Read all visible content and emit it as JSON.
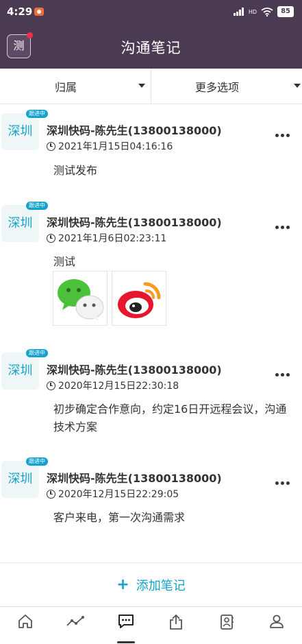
{
  "status_bar": {
    "time": "4:29",
    "network": "HD",
    "battery": "85"
  },
  "header": {
    "logo_text": "测",
    "title": "沟通笔记"
  },
  "filters": [
    {
      "label": "归属"
    },
    {
      "label": "更多选项"
    }
  ],
  "notes": [
    {
      "avatar_text": "深圳",
      "tag": "跟进中",
      "title": "深圳快码-陈先生(13800138000)",
      "time": "2021年1月15日04:16:16",
      "body": "测试发布",
      "images": []
    },
    {
      "avatar_text": "深圳",
      "tag": "跟进中",
      "title": "深圳快码-陈先生(13800138000)",
      "time": "2021年1月6日02:23:11",
      "body": "测试",
      "images": [
        "wechat-logo",
        "weibo-logo"
      ]
    },
    {
      "avatar_text": "深圳",
      "tag": "跟进中",
      "title": "深圳快码-陈先生(13800138000)",
      "time": "2020年12月15日22:30:18",
      "body": "初步确定合作意向，约定16日开远程会议，沟通技术方案",
      "images": []
    },
    {
      "avatar_text": "深圳",
      "tag": "跟进中",
      "title": "深圳快码-陈先生(13800138000)",
      "time": "2020年12月15日22:29:05",
      "body": "客户来电，第一次沟通需求",
      "images": []
    }
  ],
  "add_button": {
    "icon": "+",
    "label": "添加笔记"
  },
  "tabs": [
    {
      "icon": "home-icon"
    },
    {
      "icon": "trend-icon"
    },
    {
      "icon": "chat-icon",
      "active": true
    },
    {
      "icon": "share-icon"
    },
    {
      "icon": "contacts-icon"
    },
    {
      "icon": "user-icon"
    }
  ],
  "colors": {
    "header": "#4a3a52",
    "accent": "#12a2cc",
    "logo_dot": "#f0304a"
  }
}
